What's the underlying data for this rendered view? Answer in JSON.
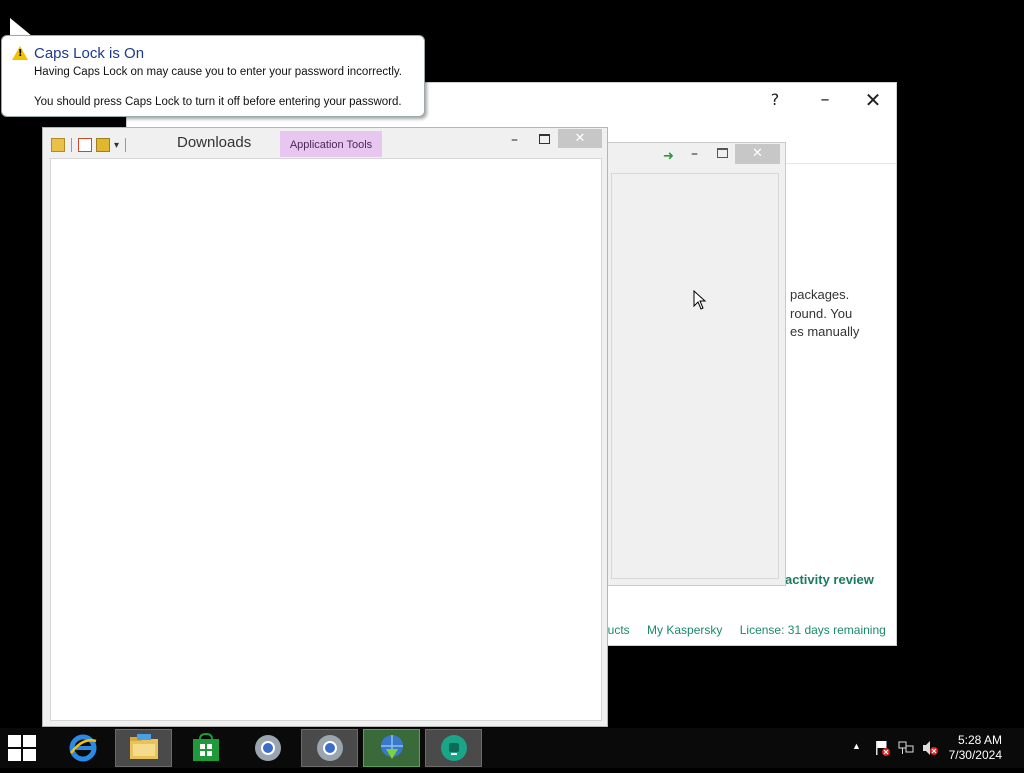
{
  "tooltip": {
    "title": "Caps Lock is On",
    "line1": "Having Caps Lock on may cause you to enter your password incorrectly.",
    "line2": "You should press Caps Lock to turn it off before entering your password."
  },
  "explorer": {
    "title": "Downloads",
    "contextual_tab": "Application Tools",
    "minimize": "–",
    "close": "✕"
  },
  "kaspersky": {
    "help": "?",
    "minimize": "–",
    "close": "✕",
    "desc_lines": [
      "packages.",
      "round. You",
      "es manually"
    ],
    "activity": "activity review",
    "footer": [
      "ducts",
      "My Kaspersky",
      "License: 31 days remaining"
    ]
  },
  "middle_window": {
    "minimize": "–",
    "close": "✕"
  },
  "taskbar": {
    "items": [
      "Internet Explorer",
      "File Explorer",
      "Store",
      "Chrome",
      "Chrome",
      "Internet Download Manager",
      "Kaspersky"
    ],
    "clock_time": "5:28 AM",
    "clock_date": "7/30/2024"
  }
}
